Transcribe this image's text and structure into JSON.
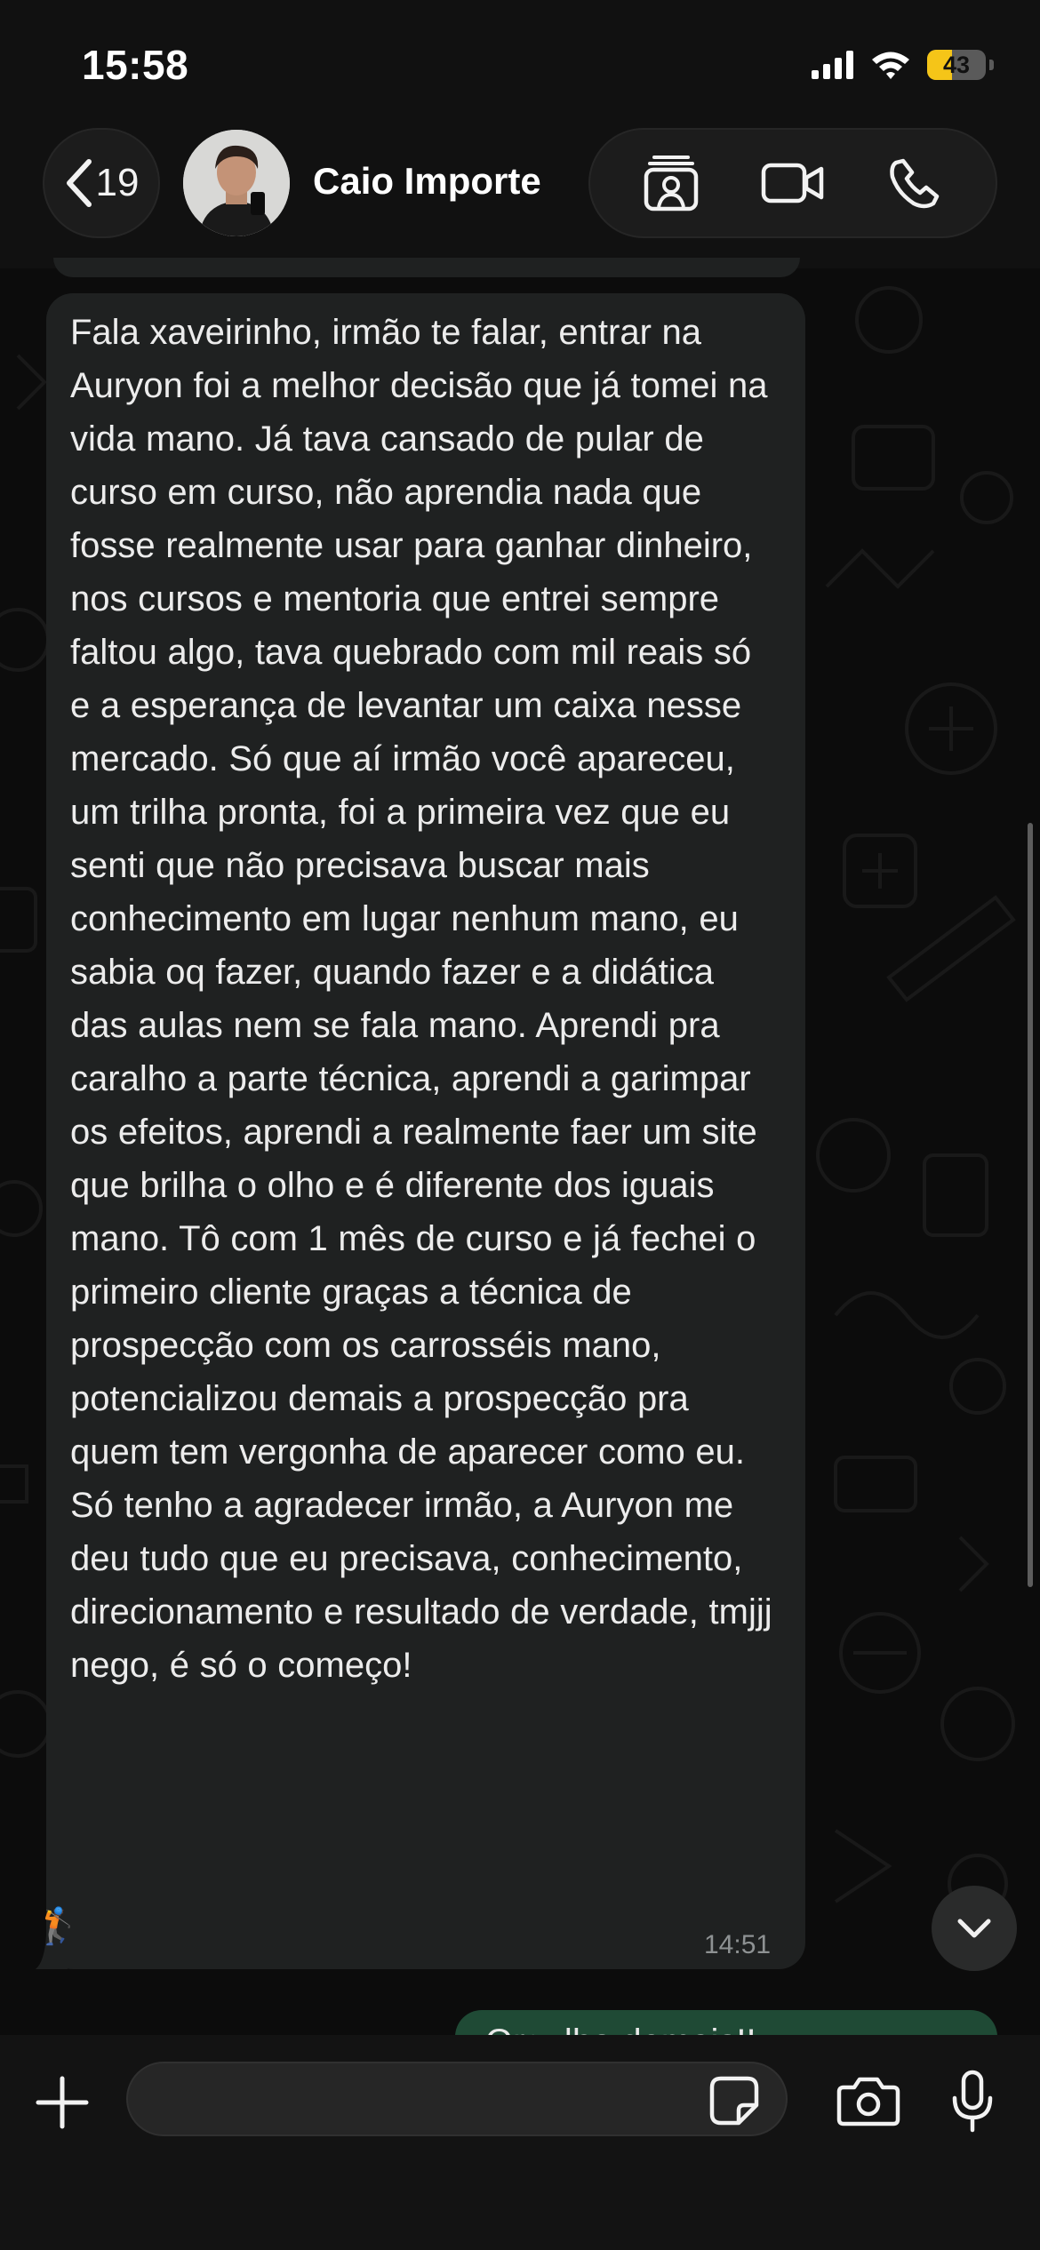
{
  "status_bar": {
    "time": "15:58",
    "battery_level": "43",
    "signal_icon": "cellular-signal-icon",
    "wifi_icon": "wifi-icon"
  },
  "header": {
    "back_icon": "chevron-left-icon",
    "unread_count": "19",
    "contact_name": "Caio Importe",
    "actions": [
      "contact-card-icon",
      "video-call-icon",
      "phone-call-icon"
    ]
  },
  "chat": {
    "message": {
      "text": "Fala xaveirinho, irmão te falar, entrar na Auryon foi a melhor decisão que já tomei na vida mano. Já tava cansado de pular de curso em curso, não aprendia nada que fosse realmente usar para ganhar dinheiro, nos cursos e mentoria que entrei sempre faltou algo, tava quebrado com mil reais só e a esperança de levantar um caixa nesse mercado. Só que aí irmão você apareceu, um trilha pronta, foi a primeira vez que eu senti que não precisava buscar mais conhecimento em lugar nenhum mano, eu sabia oq fazer, quando fazer e a didática das aulas nem se fala mano. Aprendi pra caralho a parte técnica, aprendi a garimpar os efeitos, aprendi a realmente faer um site que brilha o olho e é diferente dos iguais mano. Tô com 1 mês de curso e já fechei o primeiro cliente graças a técnica de prospecção com os carrosséis mano, potencializou demais a prospecção pra quem tem vergonha de aparecer como eu. Só tenho a agradecer irmão, a Auryon me deu tudo que eu precisava, conhecimento, direcionamento e resultado de verdade, tmjjj nego, é só o começo!",
      "emoji": "🏌️",
      "time": "14:51"
    },
    "sent_preview": "Orgulho demais!!"
  },
  "input_bar": {
    "placeholder": "",
    "plus_icon": "plus-icon",
    "sticker_icon": "sticker-icon",
    "camera_icon": "camera-icon",
    "mic_icon": "microphone-icon"
  },
  "colors": {
    "background": "#0c0c0c",
    "bubble_received": "#1f2121",
    "bubble_sent": "#1f4a35",
    "battery_fill": "#f5c518",
    "header_bg": "#111111"
  }
}
